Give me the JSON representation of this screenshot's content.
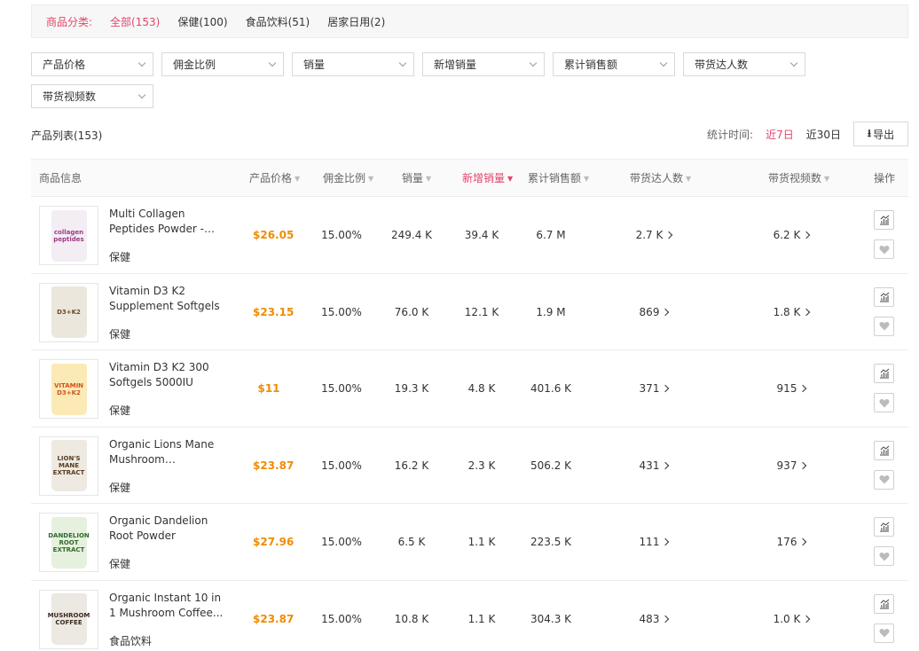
{
  "categories": {
    "label": "商品分类:",
    "items": [
      "全部(153)",
      "保健(100)",
      "食品饮料(51)",
      "居家日用(2)"
    ],
    "active_index": 0
  },
  "filters": [
    "产品价格",
    "佣金比例",
    "销量",
    "新增销量",
    "累计销售额",
    "带货达人数",
    "带货视频数"
  ],
  "list": {
    "title": "产品列表(153)",
    "stat_label": "统计时间:",
    "stat_options": [
      "近7日",
      "近30日"
    ],
    "active_stat": "近7日",
    "export_label": "导出"
  },
  "columns": {
    "info": "商品信息",
    "price": "产品价格",
    "commission": "佣金比例",
    "sales": "销量",
    "new_sales": "新增销量",
    "revenue": "累计销售额",
    "creators": "带货达人数",
    "videos": "带货视频数",
    "action": "操作"
  },
  "colors": {
    "accent": "#e2466a",
    "price": "#f08c00"
  },
  "rows": [
    {
      "name": "Multi Collagen Peptides Powder - Hydrolyzed...",
      "category": "保健",
      "price": "$26.05",
      "commission": "15.00%",
      "sales": "249.4 K",
      "new_sales": "39.4 K",
      "revenue": "6.7 M",
      "creators": "2.7 K",
      "videos": "6.2 K",
      "pkg": {
        "line1": "collagen",
        "line2": "peptides",
        "bg": "#f3eef3",
        "fg": "#9b3b8a"
      }
    },
    {
      "name": "Vitamin D3 K2 Supplement Softgels",
      "category": "保健",
      "price": "$23.15",
      "commission": "15.00%",
      "sales": "76.0 K",
      "new_sales": "12.1 K",
      "revenue": "1.9 M",
      "creators": "869",
      "videos": "1.8 K",
      "pkg": {
        "line1": "D3+K2",
        "line2": "",
        "bg": "#ece7dc",
        "fg": "#6b4b2a"
      }
    },
    {
      "name": "Vitamin D3 K2 300 Softgels 5000IU",
      "category": "保健",
      "price": "$11",
      "commission": "15.00%",
      "sales": "19.3 K",
      "new_sales": "4.8 K",
      "revenue": "401.6 K",
      "creators": "371",
      "videos": "915",
      "pkg": {
        "line1": "VITAMIN",
        "line2": "D3+K2",
        "bg": "#fbe9b6",
        "fg": "#d0531c"
      }
    },
    {
      "name": "Organic Lions Mane Mushroom Supplement...",
      "category": "保健",
      "price": "$23.87",
      "commission": "15.00%",
      "sales": "16.2 K",
      "new_sales": "2.3 K",
      "revenue": "506.2 K",
      "creators": "431",
      "videos": "937",
      "pkg": {
        "line1": "LION'S MANE",
        "line2": "EXTRACT",
        "bg": "#eeeae2",
        "fg": "#5a3b22"
      }
    },
    {
      "name": "Organic Dandelion Root Powder",
      "category": "保健",
      "price": "$27.96",
      "commission": "15.00%",
      "sales": "6.5 K",
      "new_sales": "1.1 K",
      "revenue": "223.5 K",
      "creators": "111",
      "videos": "176",
      "pkg": {
        "line1": "DANDELION",
        "line2": "ROOT EXTRACT",
        "bg": "#e6f0de",
        "fg": "#2f6b2a"
      }
    },
    {
      "name": "Organic Instant 10 in 1 Mushroom Coffee...",
      "category": "食品饮料",
      "price": "$23.87",
      "commission": "15.00%",
      "sales": "10.8 K",
      "new_sales": "1.1 K",
      "revenue": "304.3 K",
      "creators": "483",
      "videos": "1.0 K",
      "pkg": {
        "line1": "MUSHROOM",
        "line2": "COFFEE",
        "bg": "#ece8e2",
        "fg": "#3a2a20"
      }
    }
  ]
}
